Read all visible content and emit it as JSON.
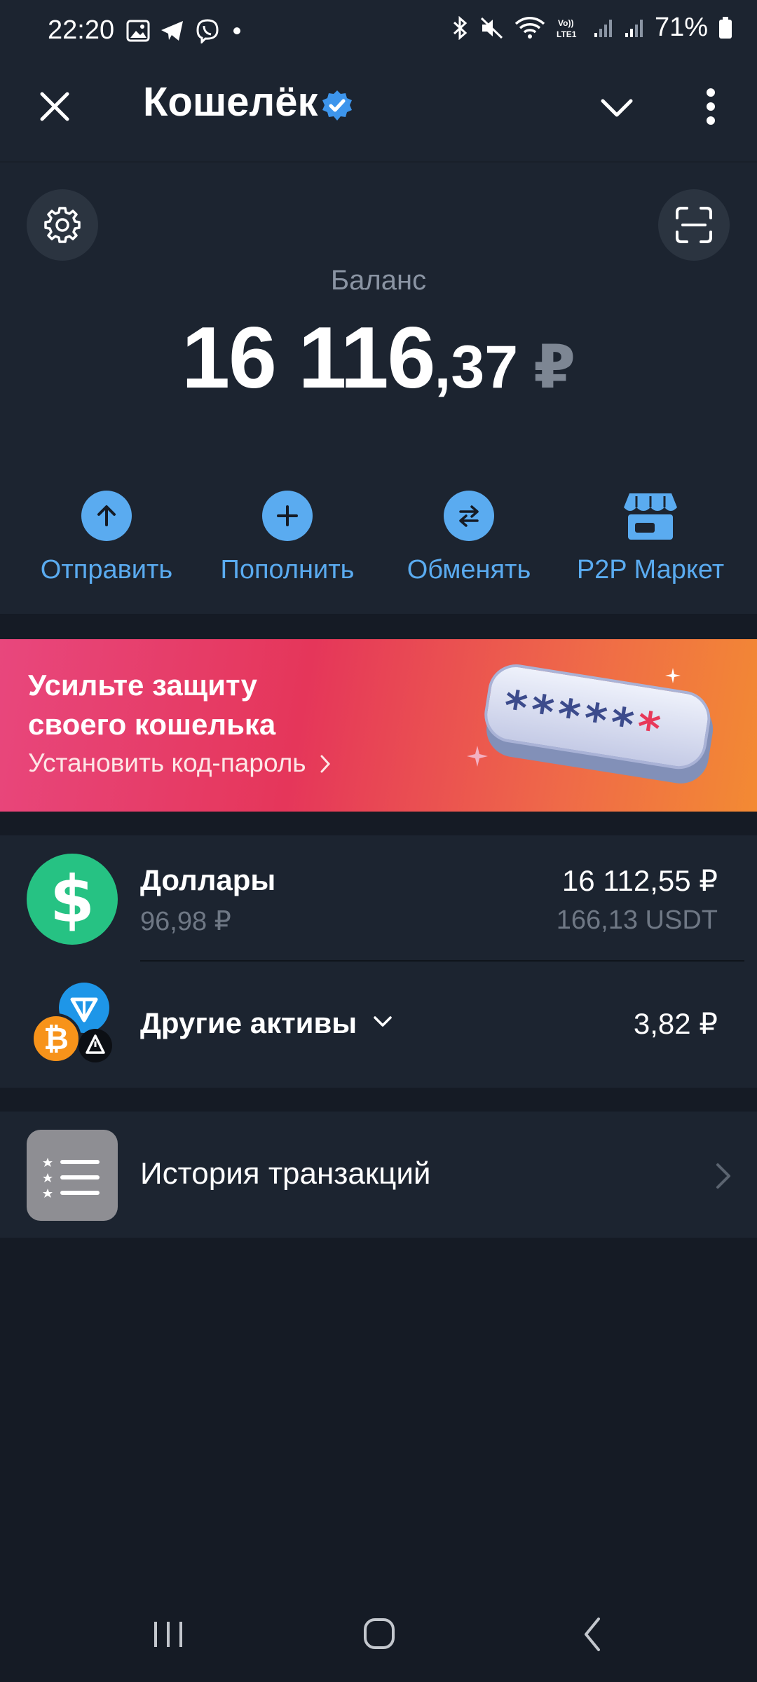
{
  "status": {
    "time": "22:20",
    "battery": "71%"
  },
  "header": {
    "title": "Кошелёк"
  },
  "balance": {
    "label": "Баланс",
    "integer": "16 116",
    "fraction": ",37",
    "currency": "₽"
  },
  "actions": [
    {
      "label": "Отправить",
      "icon": "arrow-up-icon"
    },
    {
      "label": "Пополнить",
      "icon": "plus-icon"
    },
    {
      "label": "Обменять",
      "icon": "exchange-icon"
    },
    {
      "label": "P2P Маркет",
      "icon": "store-icon"
    }
  ],
  "promo": {
    "title_line1": "Усильте защиту",
    "title_line2": "своего кошелька",
    "link": "Установить код-пароль",
    "password_mask": "*****",
    "password_last": "*"
  },
  "assets": [
    {
      "name": "Доллары",
      "sub": "96,98 ₽",
      "value": "16 112,55 ₽",
      "value_sub": "166,13 USDT"
    },
    {
      "name": "Другие активы",
      "value": "3,82 ₽"
    }
  ],
  "history": {
    "label": "История транзакций"
  },
  "colors": {
    "accent": "#5aabf0",
    "usdt_green": "#26c283",
    "background": "#151b25",
    "card": "#1c2430"
  }
}
